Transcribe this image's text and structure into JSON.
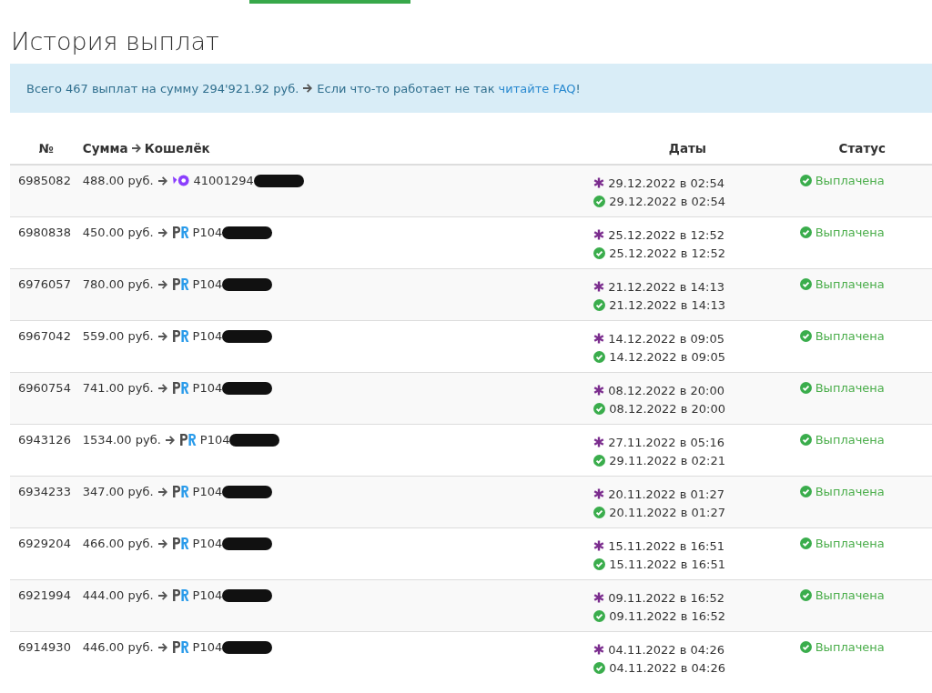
{
  "title": "История выплат",
  "summary": {
    "text": "Всего 467 выплат на сумму 294'921.92 руб.",
    "note": "Если что-то работает не так",
    "link": "читайте FAQ",
    "tail": "!"
  },
  "table": {
    "columns": [
      {
        "kind": "number",
        "label": "№"
      },
      {
        "kind": "amount",
        "label": "Сумма",
        "label2": "Кошелёк"
      },
      {
        "kind": "dates",
        "label": "Даты"
      },
      {
        "kind": "status",
        "label": "Статус"
      }
    ],
    "rows": [
      {
        "id": "6985082",
        "amount": "488.00 руб.",
        "wallet": {
          "kind": "yoomoney",
          "number": "41001294"
        },
        "created": "29.12.2022 в 02:54",
        "paid": "29.12.2022 в 02:54",
        "status": {
          "kind": "paid",
          "label": "Выплачена"
        }
      },
      {
        "id": "6980838",
        "amount": "450.00 руб.",
        "wallet": {
          "kind": "payeer",
          "number": "P104"
        },
        "created": "25.12.2022 в 12:52",
        "paid": "25.12.2022 в 12:52",
        "status": {
          "kind": "paid",
          "label": "Выплачена"
        }
      },
      {
        "id": "6976057",
        "amount": "780.00 руб.",
        "wallet": {
          "kind": "payeer",
          "number": "P104"
        },
        "created": "21.12.2022 в 14:13",
        "paid": "21.12.2022 в 14:13",
        "status": {
          "kind": "paid",
          "label": "Выплачена"
        }
      },
      {
        "id": "6967042",
        "amount": "559.00 руб.",
        "wallet": {
          "kind": "payeer",
          "number": "P104"
        },
        "created": "14.12.2022 в 09:05",
        "paid": "14.12.2022 в 09:05",
        "status": {
          "kind": "paid",
          "label": "Выплачена"
        }
      },
      {
        "id": "6960754",
        "amount": "741.00 руб.",
        "wallet": {
          "kind": "payeer",
          "number": "P104"
        },
        "created": "08.12.2022 в 20:00",
        "paid": "08.12.2022 в 20:00",
        "status": {
          "kind": "paid",
          "label": "Выплачена"
        }
      },
      {
        "id": "6943126",
        "amount": "1534.00 руб.",
        "wallet": {
          "kind": "payeer",
          "number": "P104"
        },
        "created": "27.11.2022 в 05:16",
        "paid": "29.11.2022 в 02:21",
        "status": {
          "kind": "paid",
          "label": "Выплачена"
        }
      },
      {
        "id": "6934233",
        "amount": "347.00 руб.",
        "wallet": {
          "kind": "payeer",
          "number": "P104"
        },
        "created": "20.11.2022 в 01:27",
        "paid": "20.11.2022 в 01:27",
        "status": {
          "kind": "paid",
          "label": "Выплачена"
        }
      },
      {
        "id": "6929204",
        "amount": "466.00 руб.",
        "wallet": {
          "kind": "payeer",
          "number": "P104"
        },
        "created": "15.11.2022 в 16:51",
        "paid": "15.11.2022 в 16:51",
        "status": {
          "kind": "paid",
          "label": "Выплачена"
        }
      },
      {
        "id": "6921994",
        "amount": "444.00 руб.",
        "wallet": {
          "kind": "payeer",
          "number": "P104"
        },
        "created": "09.11.2022 в 16:52",
        "paid": "09.11.2022 в 16:52",
        "status": {
          "kind": "paid",
          "label": "Выплачена"
        }
      },
      {
        "id": "6914930",
        "amount": "446.00 руб.",
        "wallet": {
          "kind": "payeer",
          "number": "P104"
        },
        "created": "04.11.2022 в 04:26",
        "paid": "04.11.2022 в 04:26",
        "status": {
          "kind": "paid",
          "label": "Выплачена"
        }
      }
    ]
  }
}
